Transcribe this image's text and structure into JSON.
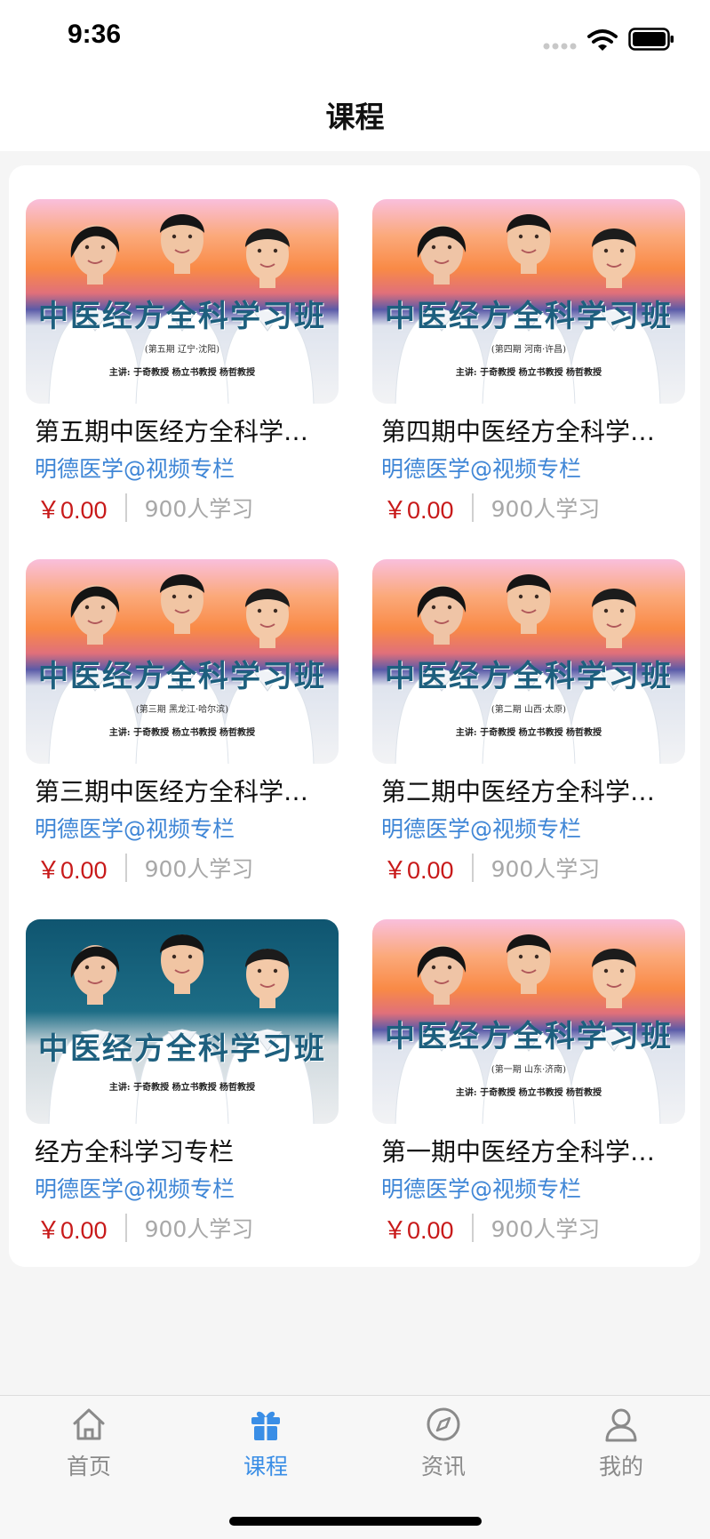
{
  "status": {
    "time": "9:36"
  },
  "header": {
    "title": "课程"
  },
  "courses": [
    {
      "title": "第五期中医经方全科学…",
      "author": "明德医学@视频专栏",
      "price": "￥0.00",
      "learners": "900人学习",
      "poster": {
        "heading": "中医经方全科学习班",
        "session": "(第五期 辽宁·沈阳)",
        "lecturers": "主讲: 于奇教授  杨立书教授  杨哲教授",
        "theme": "sunset"
      }
    },
    {
      "title": "第四期中医经方全科学…",
      "author": "明德医学@视频专栏",
      "price": "￥0.00",
      "learners": "900人学习",
      "poster": {
        "heading": "中医经方全科学习班",
        "session": "(第四期 河南·许昌)",
        "lecturers": "主讲: 于奇教授  杨立书教授  杨哲教授",
        "theme": "sunset"
      }
    },
    {
      "title": "第三期中医经方全科学…",
      "author": "明德医学@视频专栏",
      "price": "￥0.00",
      "learners": "900人学习",
      "poster": {
        "heading": "中医经方全科学习班",
        "session": "(第三期 黑龙江·哈尔滨)",
        "lecturers": "主讲: 于奇教授  杨立书教授  杨哲教授",
        "theme": "sunset"
      }
    },
    {
      "title": "第二期中医经方全科学…",
      "author": "明德医学@视频专栏",
      "price": "￥0.00",
      "learners": "900人学习",
      "poster": {
        "heading": "中医经方全科学习班",
        "session": "(第二期 山西·太原)",
        "lecturers": "主讲: 于奇教授  杨立书教授  杨哲教授",
        "theme": "sunset"
      }
    },
    {
      "title": "经方全科学习专栏",
      "author": "明德医学@视频专栏",
      "price": "￥0.00",
      "learners": "900人学习",
      "poster": {
        "heading": "中医经方全科学习班",
        "session": "",
        "lecturers": "主讲: 于奇教授  杨立书教授  杨哲教授",
        "theme": "teal"
      }
    },
    {
      "title": "第一期中医经方全科学…",
      "author": "明德医学@视频专栏",
      "price": "￥0.00",
      "learners": "900人学习",
      "poster": {
        "heading": "中医经方全科学习班",
        "session": "(第一期 山东·济南)",
        "lecturers": "主讲: 于奇教授  杨立书教授  杨哲教授",
        "theme": "sunset"
      }
    }
  ],
  "tabs": [
    {
      "label": "首页",
      "icon": "home-icon",
      "active": false
    },
    {
      "label": "课程",
      "icon": "gift-icon",
      "active": true
    },
    {
      "label": "资讯",
      "icon": "compass-icon",
      "active": false
    },
    {
      "label": "我的",
      "icon": "person-icon",
      "active": false
    }
  ],
  "colors": {
    "accent": "#3a8ee6",
    "price": "#c81a1a",
    "author": "#3f86d6",
    "inactive_tab": "#8a8a8a",
    "poster_heading": "#1d5f7e"
  }
}
